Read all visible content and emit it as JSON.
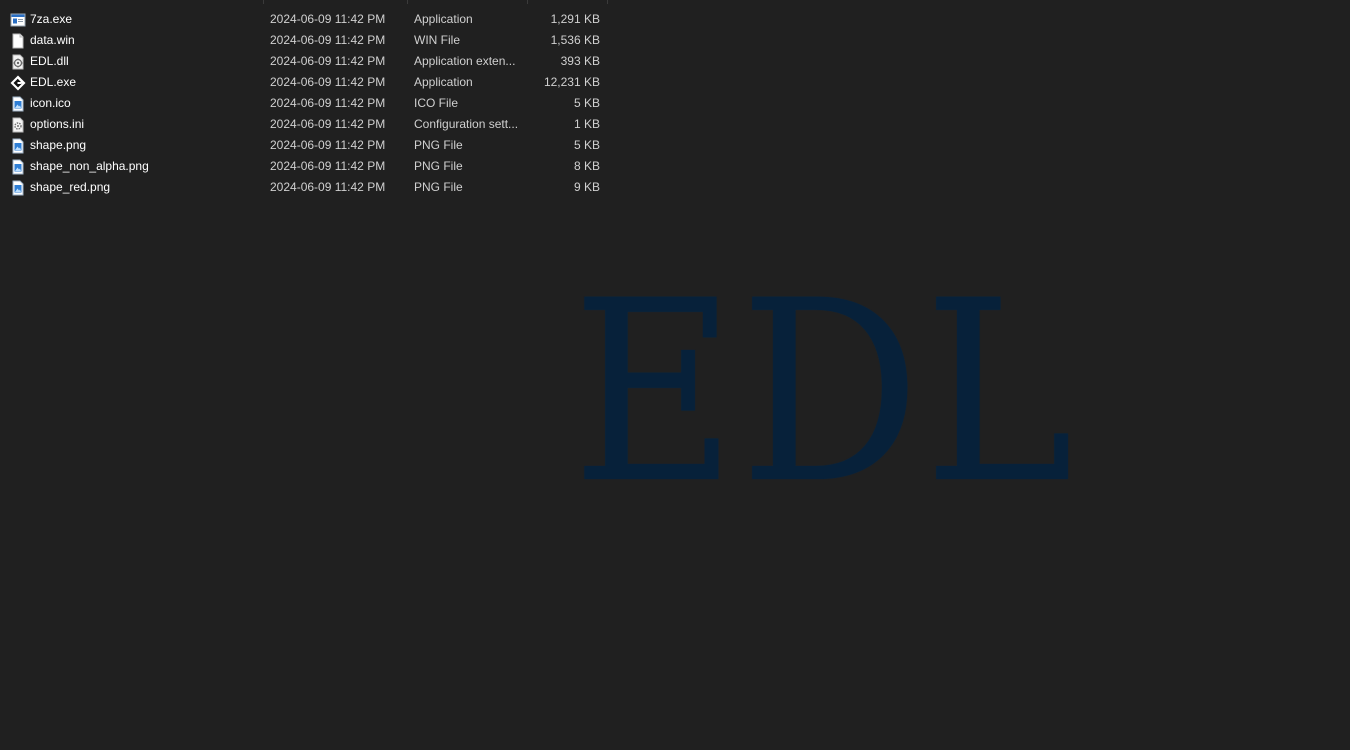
{
  "files": [
    {
      "name": "7za.exe",
      "date": "2024-06-09 11:42 PM",
      "type": "Application",
      "size": "1,291 KB",
      "icon": "app-window-icon"
    },
    {
      "name": "data.win",
      "date": "2024-06-09 11:42 PM",
      "type": "WIN File",
      "size": "1,536 KB",
      "icon": "blank-file-icon"
    },
    {
      "name": "EDL.dll",
      "date": "2024-06-09 11:42 PM",
      "type": "Application exten...",
      "size": "393 KB",
      "icon": "dll-gear-icon"
    },
    {
      "name": "EDL.exe",
      "date": "2024-06-09 11:42 PM",
      "type": "Application",
      "size": "12,231 KB",
      "icon": "gamemaker-icon"
    },
    {
      "name": "icon.ico",
      "date": "2024-06-09 11:42 PM",
      "type": "ICO File",
      "size": "5 KB",
      "icon": "image-file-icon"
    },
    {
      "name": "options.ini",
      "date": "2024-06-09 11:42 PM",
      "type": "Configuration sett...",
      "size": "1 KB",
      "icon": "config-file-icon"
    },
    {
      "name": "shape.png",
      "date": "2024-06-09 11:42 PM",
      "type": "PNG File",
      "size": "5 KB",
      "icon": "image-file-icon"
    },
    {
      "name": "shape_non_alpha.png",
      "date": "2024-06-09 11:42 PM",
      "type": "PNG File",
      "size": "8 KB",
      "icon": "image-file-icon"
    },
    {
      "name": "shape_red.png",
      "date": "2024-06-09 11:42 PM",
      "type": "PNG File",
      "size": "9 KB",
      "icon": "image-file-icon"
    }
  ],
  "watermark": "EDL",
  "colors": {
    "background": "#202020",
    "watermark": "#07213a",
    "text": "#ffffff",
    "secondary_text": "#d0d0d0"
  }
}
